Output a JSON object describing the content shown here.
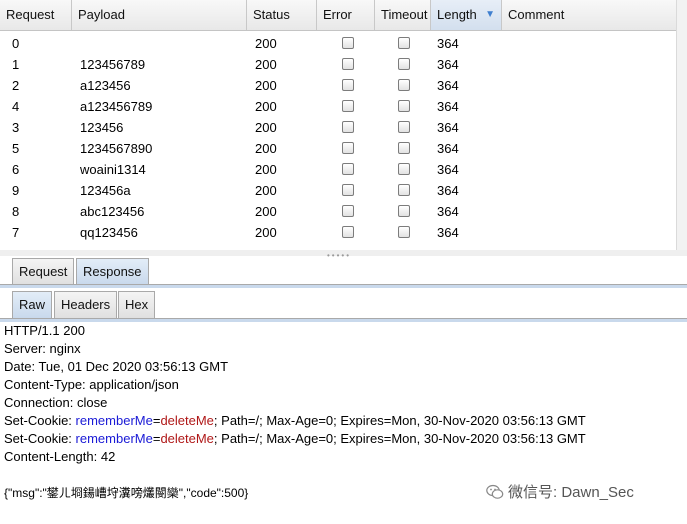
{
  "table": {
    "columns": [
      "Request",
      "Payload",
      "Status",
      "Error",
      "Timeout",
      "Length",
      "Comment"
    ],
    "sorted_column": "Length",
    "sort_direction": "descending",
    "rows": [
      {
        "request": "0",
        "payload": "",
        "status": "200",
        "error": false,
        "timeout": false,
        "length": "364"
      },
      {
        "request": "1",
        "payload": "123456789",
        "status": "200",
        "error": false,
        "timeout": false,
        "length": "364"
      },
      {
        "request": "2",
        "payload": "a123456",
        "status": "200",
        "error": false,
        "timeout": false,
        "length": "364"
      },
      {
        "request": "4",
        "payload": "a123456789",
        "status": "200",
        "error": false,
        "timeout": false,
        "length": "364"
      },
      {
        "request": "3",
        "payload": "123456",
        "status": "200",
        "error": false,
        "timeout": false,
        "length": "364"
      },
      {
        "request": "5",
        "payload": "1234567890",
        "status": "200",
        "error": false,
        "timeout": false,
        "length": "364"
      },
      {
        "request": "6",
        "payload": "woaini1314",
        "status": "200",
        "error": false,
        "timeout": false,
        "length": "364"
      },
      {
        "request": "9",
        "payload": "123456a",
        "status": "200",
        "error": false,
        "timeout": false,
        "length": "364"
      },
      {
        "request": "8",
        "payload": "abc123456",
        "status": "200",
        "error": false,
        "timeout": false,
        "length": "364"
      },
      {
        "request": "7",
        "payload": "qq123456",
        "status": "200",
        "error": false,
        "timeout": false,
        "length": "364"
      }
    ]
  },
  "main_tabs": {
    "request": "Request",
    "response": "Response",
    "active": "Response"
  },
  "sub_tabs": {
    "raw": "Raw",
    "headers": "Headers",
    "hex": "Hex",
    "active": "Raw"
  },
  "response": {
    "status_line": "HTTP/1.1 200",
    "server": "Server: nginx",
    "date": "Date: Tue, 01 Dec 2020 03:56:13 GMT",
    "content_type": "Content-Type: application/json",
    "connection": "Connection: close",
    "set_cookie_prefix": "Set-Cookie: ",
    "cookie_name": "rememberMe",
    "cookie_eq": "=",
    "cookie_value": "deleteMe",
    "cookie_rest": "; Path=/; Max-Age=0; Expires=Mon, 30-Nov-2020 03:56:13 GMT",
    "content_length": "Content-Length: 42",
    "body": "{\"msg\":\"鐢ㄦ埛鍚嶆垨瀵嗙爜閿欒\",\"code\":500}"
  },
  "watermark": {
    "text": "微信号: Dawn_Sec",
    "icon": "wechat-icon"
  },
  "colors": {
    "cookie_key": "#1a1ad6",
    "cookie_value": "#b01818",
    "active_tab": "#c9d9ec",
    "sort_arrow": "#3f7fcf"
  }
}
